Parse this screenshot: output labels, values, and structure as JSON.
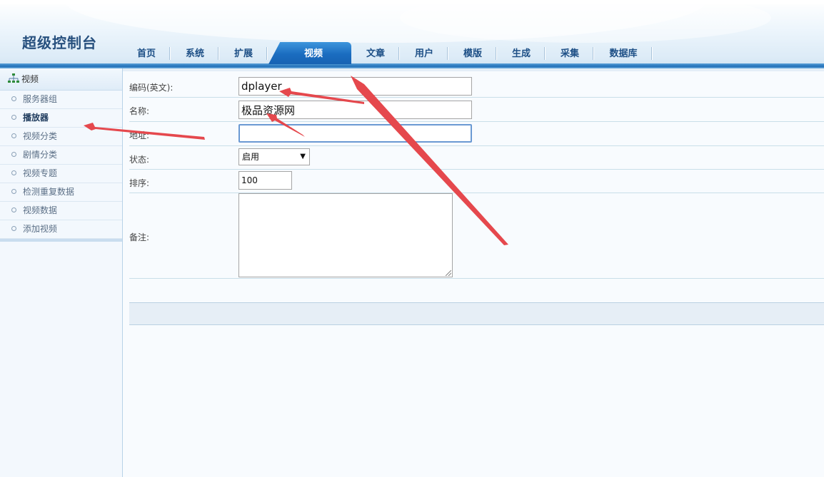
{
  "header": {
    "brand": "超级控制台",
    "nav": [
      {
        "label": "首页"
      },
      {
        "label": "系统"
      },
      {
        "label": "扩展"
      },
      {
        "label": "视频",
        "active": true
      },
      {
        "label": "文章"
      },
      {
        "label": "用户"
      },
      {
        "label": "模版"
      },
      {
        "label": "生成"
      },
      {
        "label": "采集"
      },
      {
        "label": "数据库"
      }
    ]
  },
  "sidebar": {
    "title": "视频",
    "items": [
      {
        "label": "服务器组"
      },
      {
        "label": "播放器",
        "active": true
      },
      {
        "label": "视频分类"
      },
      {
        "label": "剧情分类"
      },
      {
        "label": "视频专题"
      },
      {
        "label": "检测重复数据"
      },
      {
        "label": "视频数据"
      },
      {
        "label": "添加视频"
      }
    ]
  },
  "form": {
    "code_label": "编码(英文):",
    "code_value": "dplayer",
    "name_label": "名称:",
    "name_value": "极品资源网",
    "address_label": "地址:",
    "address_value": "",
    "status_label": "状态:",
    "status_value": "启用",
    "sort_label": "排序:",
    "sort_value": "100",
    "remark_label": "备注:",
    "remark_value": ""
  },
  "colors": {
    "accent": "#1a6cc0",
    "brand_text": "#27507e",
    "annotation_arrow": "#e5484d"
  }
}
